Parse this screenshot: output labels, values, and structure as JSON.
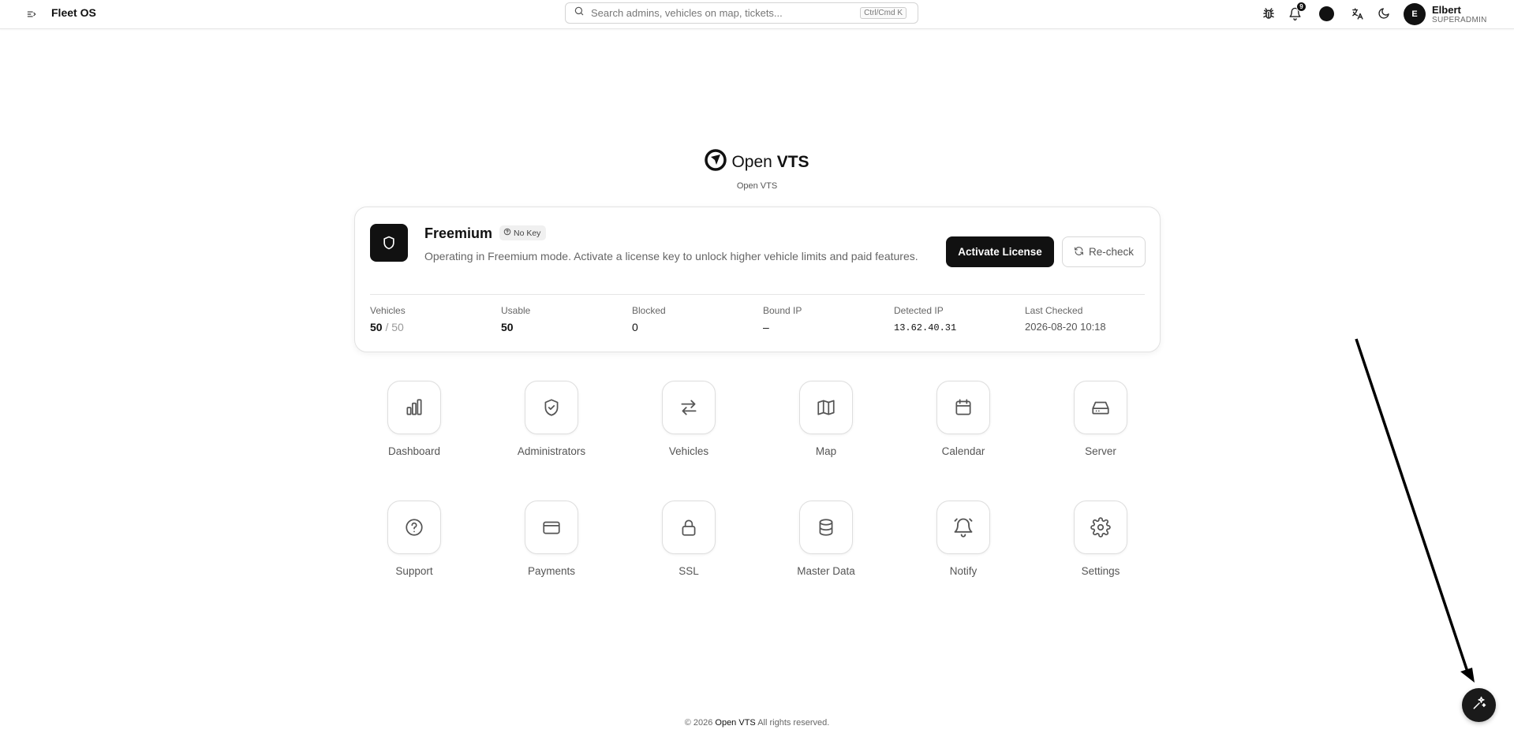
{
  "header": {
    "brand": "Fleet OS",
    "search_placeholder": "Search admins, vehicles on map, tickets...",
    "search_shortcut": "Ctrl/Cmd K",
    "notification_count": "9",
    "icons": [
      "bug-icon",
      "bell-icon",
      "theme-dot",
      "translate-icon",
      "moon-icon"
    ],
    "user": {
      "initial": "E",
      "name": "Elbert",
      "role": "SUPERADMIN"
    }
  },
  "logo": {
    "prefix": "Open ",
    "bold": "VTS",
    "subtitle": "Open VTS"
  },
  "license": {
    "plan": "Freemium",
    "badge": "No Key",
    "description": "Operating in Freemium mode. Activate a license key to unlock higher vehicle limits and paid features.",
    "activate_label": "Activate License",
    "recheck_label": "Re-check",
    "stats": {
      "vehicles": {
        "label": "Vehicles",
        "used": "50",
        "sep": " / ",
        "limit": "50"
      },
      "usable": {
        "label": "Usable",
        "value": "50"
      },
      "blocked": {
        "label": "Blocked",
        "value": "0"
      },
      "bound_ip": {
        "label": "Bound IP",
        "value": "–"
      },
      "detected_ip": {
        "label": "Detected IP",
        "value": "13.62.40.31"
      },
      "last_checked": {
        "label": "Last Checked",
        "value": "2026-08-20 10:18"
      }
    }
  },
  "apps": [
    {
      "label": "Dashboard",
      "icon": "bar-chart-icon"
    },
    {
      "label": "Administrators",
      "icon": "shield-check-icon"
    },
    {
      "label": "Vehicles",
      "icon": "arrows-left-right-icon"
    },
    {
      "label": "Map",
      "icon": "map-icon"
    },
    {
      "label": "Calendar",
      "icon": "calendar-icon"
    },
    {
      "label": "Server",
      "icon": "hard-drive-icon"
    },
    {
      "label": "Support",
      "icon": "help-circle-icon"
    },
    {
      "label": "Payments",
      "icon": "credit-card-icon"
    },
    {
      "label": "SSL",
      "icon": "lock-icon"
    },
    {
      "label": "Master Data",
      "icon": "database-icon"
    },
    {
      "label": "Notify",
      "icon": "bell-ring-icon"
    },
    {
      "label": "Settings",
      "icon": "gear-icon"
    }
  ],
  "footer": {
    "prefix": "© 2026 ",
    "brand": "Open VTS",
    "suffix": " All rights reserved."
  },
  "fab": {
    "icon": "sparkles-icon"
  },
  "colors": {
    "accent": "#111111",
    "muted_text": "#666666",
    "border": "#e2e2e2"
  }
}
